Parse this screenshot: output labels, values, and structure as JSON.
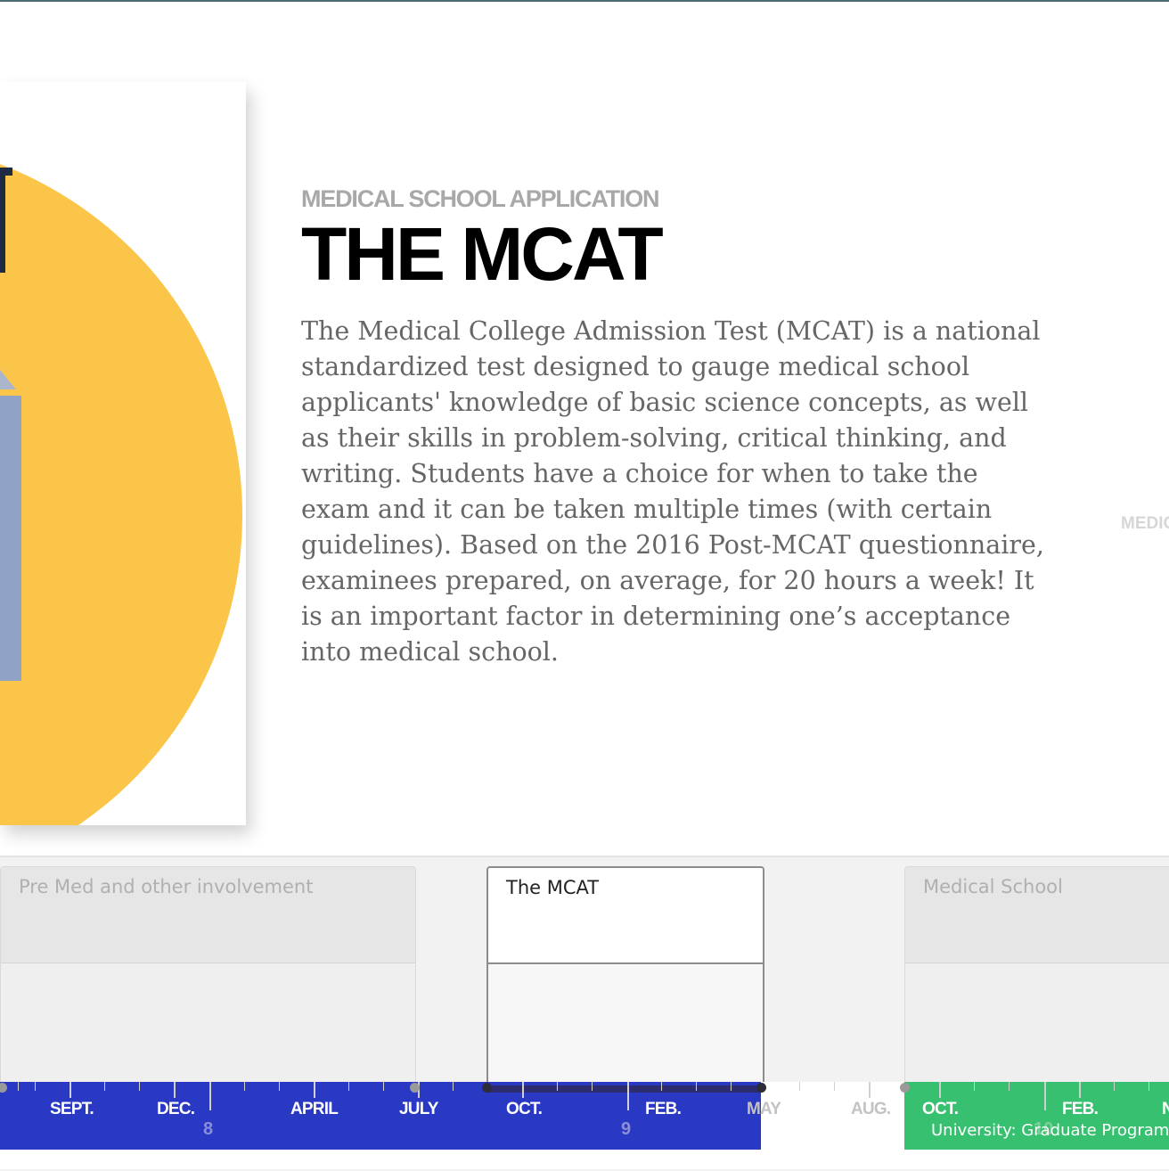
{
  "slide": {
    "eyebrow": "MEDICAL SCHOOL APPLICATION",
    "headline": "THE MCAT",
    "body": "The Medical College Admission Test (MCAT) is a national standardized test designed to gauge medical school applicants' knowledge of basic science concepts, as well as their skills in problem-solving, critical thinking, and writing. Students have a choice for when to take the exam and it can be taken multiple times (with certain guidelines). Based on the 2016 Post-MCAT questionnaire, examinees prepared, on average, for 20 hours a week! It is an important factor in determining one’s acceptance into medical school.",
    "next_slide_peek": "MEDICA",
    "illustration_colors": {
      "circle": "#fbc54a",
      "building": "#8fa3c6",
      "dark": "#1e2a44"
    }
  },
  "eras": [
    {
      "label": "Pre Med and other involvement",
      "active": false
    },
    {
      "label": "The MCAT",
      "active": true
    },
    {
      "label": "Medical School",
      "active": false
    }
  ],
  "axis": {
    "months": [
      "SEPT.",
      "DEC.",
      "APRIL",
      "JULY",
      "OCT.",
      "FEB.",
      "MAY",
      "AUG.",
      "OCT.",
      "FEB.",
      "N"
    ],
    "years": [
      "8",
      "9",
      "10"
    ],
    "span_label": "University: Graduate Program, M",
    "colors": {
      "blue": "#2a39c3",
      "green": "#37c06f"
    }
  }
}
